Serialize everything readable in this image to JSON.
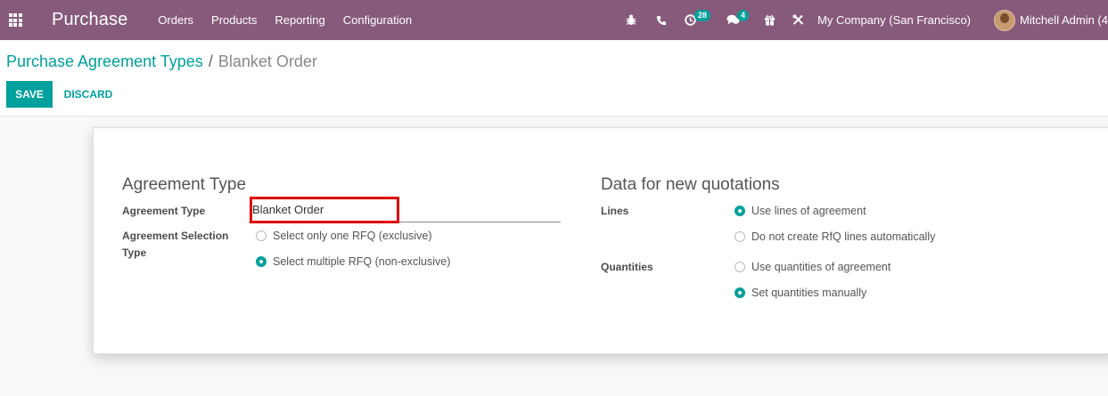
{
  "navbar": {
    "app_name": "Purchase",
    "menu": [
      "Orders",
      "Products",
      "Reporting",
      "Configuration"
    ],
    "activity_count": "28",
    "message_count": "4",
    "company": "My Company (San Francisco)",
    "user": "Mitchell Admin (4",
    "icons": [
      "apps-grid-icon",
      "bug-icon",
      "phone-icon",
      "clock-icon",
      "chat-icon",
      "gift-icon",
      "tools-icon"
    ]
  },
  "breadcrumb": {
    "parent": "Purchase Agreement Types",
    "separator": "/",
    "current": "Blanket Order"
  },
  "actions": {
    "save": "SAVE",
    "discard": "DISCARD"
  },
  "form": {
    "left_title": "Agreement Type",
    "agreement_type_label": "Agreement Type",
    "agreement_type_value": "Blanket Order",
    "selection_type_label": "Agreement Selection Type",
    "selection_options": [
      {
        "label": "Select only one RFQ (exclusive)",
        "checked": false
      },
      {
        "label": "Select multiple RFQ (non-exclusive)",
        "checked": true
      }
    ],
    "right_title": "Data for new quotations",
    "lines_label": "Lines",
    "lines_options": [
      {
        "label": "Use lines of agreement",
        "checked": true
      },
      {
        "label": "Do not create RfQ lines automatically",
        "checked": false
      }
    ],
    "quantities_label": "Quantities",
    "quantities_options": [
      {
        "label": "Use quantities of agreement",
        "checked": false
      },
      {
        "label": "Set quantities manually",
        "checked": true
      }
    ]
  },
  "colors": {
    "navbar": "#875a7b",
    "accent": "#00a09d",
    "highlight": "#e00000"
  }
}
